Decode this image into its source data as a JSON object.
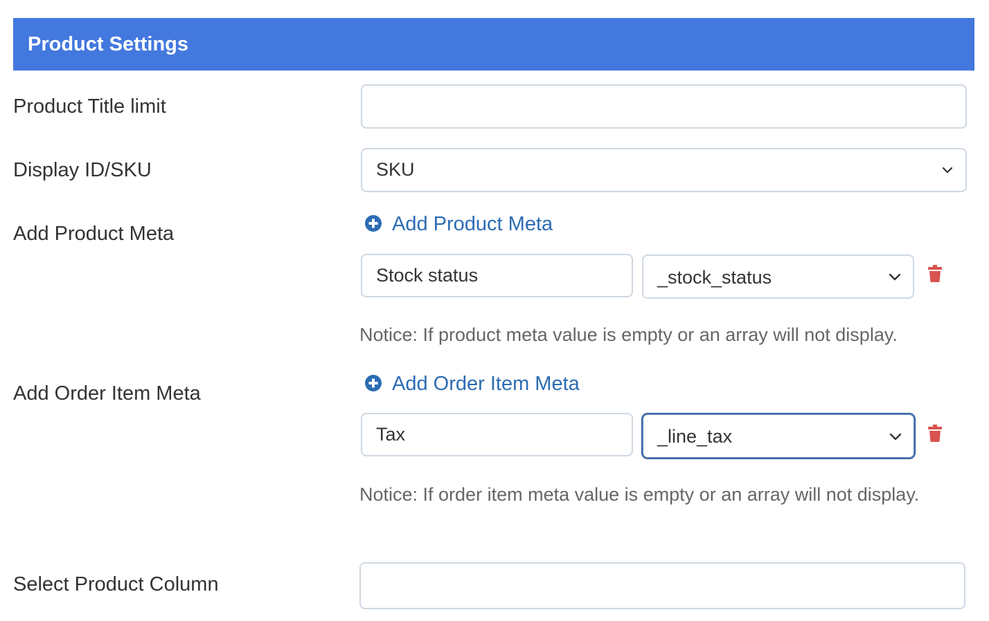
{
  "header": {
    "title": "Product Settings",
    "color": "#4378de"
  },
  "rows": {
    "title_limit": {
      "label": "Product Title limit",
      "value": ""
    },
    "display_id_sku": {
      "label": "Display ID/SKU",
      "value": "SKU"
    },
    "product_meta": {
      "label": "Add Product Meta",
      "add_link": "Add Product Meta",
      "item_name": "Stock status",
      "item_key": "_stock_status",
      "notice": "Notice: If product meta value is empty or an array will not display."
    },
    "order_item_meta": {
      "label": "Add Order Item Meta",
      "add_link": "Add Order Item Meta",
      "item_name": "Tax",
      "item_key": "_line_tax",
      "notice": "Notice: If order item meta value is empty or an array will not display."
    },
    "product_column": {
      "label": "Select Product Column",
      "value": ""
    }
  },
  "icons": {
    "add": "plus-circle-icon",
    "delete": "trash-icon",
    "dropdown": "chevron-down-icon"
  },
  "colors": {
    "link": "#2c6cb3",
    "delete": "#d9534f",
    "notice": "#666666"
  }
}
